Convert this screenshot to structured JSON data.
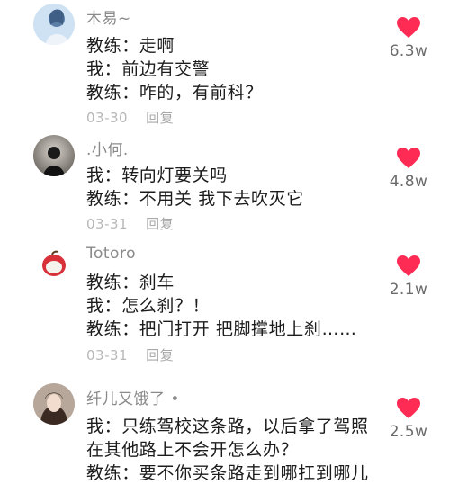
{
  "comments": [
    {
      "username": "木易~",
      "lines": [
        "教练：走啊",
        "我：前边有交警",
        "教练：咋的，有前科？"
      ],
      "date": "03-30",
      "reply_label": "回复",
      "likes": "6.3w"
    },
    {
      "username": ".小何.",
      "lines": [
        "我：转向灯要关吗",
        "教练：不用关 我下去吹灭它"
      ],
      "date": "03-31",
      "reply_label": "回复",
      "likes": "4.8w"
    },
    {
      "username": "Totoro",
      "lines": [
        "教练：刹车",
        "我：怎么刹？！",
        "教练：把门打开 把脚撑地上刹……"
      ],
      "date": "03-31",
      "reply_label": "回复",
      "likes": "2.1w"
    },
    {
      "username": "纤儿又饿了 •",
      "lines": [
        "我：只练驾校这条路，以后拿了驾照",
        "在其他路上不会开怎么办？",
        "教练：要不你买条路走到哪扛到哪儿"
      ],
      "likes": "2.5w"
    }
  ],
  "colors": {
    "heart": "#fe2c55",
    "username": "#8a8a8a",
    "text": "#1c1c1c",
    "meta": "#b8b8b8"
  }
}
